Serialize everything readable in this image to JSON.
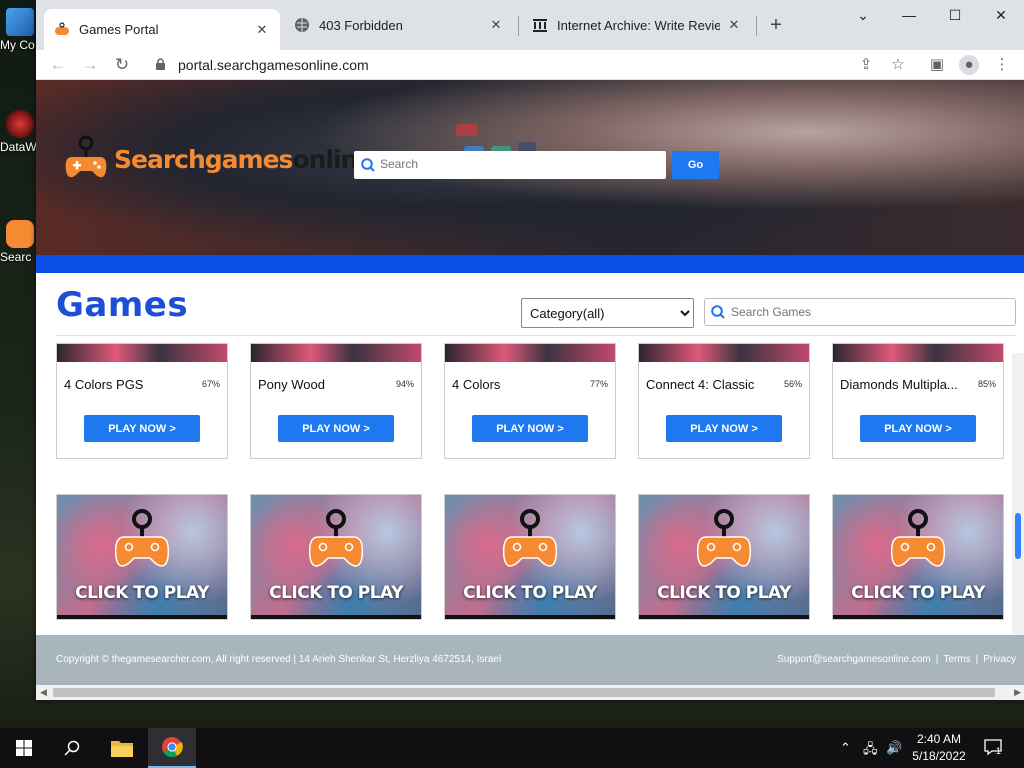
{
  "desktop": {
    "icons": [
      {
        "label": "My Co",
        "icon": "computer-icon"
      },
      {
        "label": "DataW",
        "icon": "datawatch-icon"
      },
      {
        "label": "Searc",
        "icon": "searchgames-icon"
      }
    ]
  },
  "browser": {
    "tabs": [
      {
        "title": "Games Portal",
        "icon": "gamepad-icon",
        "active": true
      },
      {
        "title": "403 Forbidden",
        "icon": "globe-icon",
        "active": false
      },
      {
        "title": "Internet Archive: Write Review",
        "icon": "archive-icon",
        "active": false
      }
    ],
    "new_tab_label": "+",
    "url": "portal.searchgamesonline.com"
  },
  "site": {
    "logo": {
      "part1": "Searchgames",
      "part2": "online"
    },
    "search_placeholder": "Search",
    "go_label": "Go",
    "games_title": "Games",
    "category_selected": "Category(all)",
    "category_options": [
      "Category(all)"
    ],
    "games_search_placeholder": "Search Games",
    "cards": [
      {
        "name": "4 Colors PGS",
        "rating": "67%",
        "button": "PLAY NOW >"
      },
      {
        "name": "Pony Wood",
        "rating": "94%",
        "button": "PLAY NOW >"
      },
      {
        "name": "4 Colors",
        "rating": "77%",
        "button": "PLAY NOW >"
      },
      {
        "name": "Connect 4: Classic",
        "rating": "56%",
        "button": "PLAY NOW >"
      },
      {
        "name": "Diamonds Multipla...",
        "rating": "85%",
        "button": "PLAY NOW >"
      }
    ],
    "tiles": [
      {
        "label": "CLICK TO PLAY"
      },
      {
        "label": "CLICK TO PLAY"
      },
      {
        "label": "CLICK TO PLAY"
      },
      {
        "label": "CLICK TO PLAY"
      },
      {
        "label": "CLICK TO PLAY"
      }
    ],
    "footer": {
      "copyright": "Copyright © thegamesearcher.com, All right reserved | 14 Arieh Shenkar St, Herzliya 4672514, Israel",
      "support": "Support@searchgamesonline.com",
      "terms": "Terms",
      "privacy": "Privacy",
      "separator": "|"
    },
    "colors": {
      "accent": "#1e78f0",
      "brand_orange": "#f58a32",
      "title_blue": "#1d4fd6",
      "bar_blue": "#0b4fe6"
    }
  },
  "taskbar": {
    "time": "2:40 AM",
    "date": "5/18/2022",
    "notification_count": "1"
  }
}
